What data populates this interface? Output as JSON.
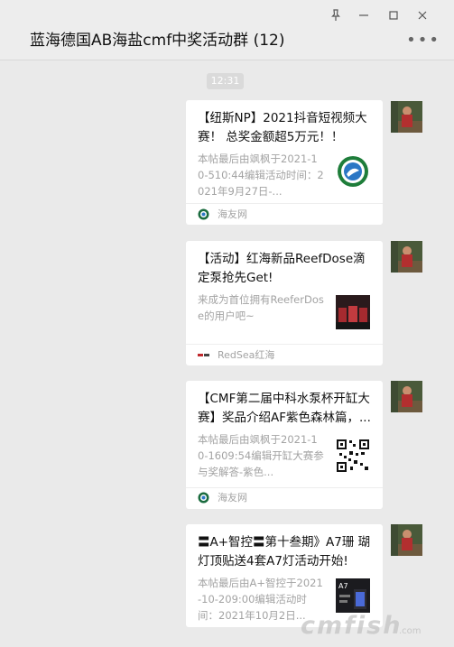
{
  "header": {
    "title": "蓝海德国AB海盐cmf中奖活动群 (12)"
  },
  "window": {
    "pin_icon": "pin-icon",
    "minimize_icon": "minimize-icon",
    "maximize_icon": "maximize-icon",
    "close_icon": "close-icon"
  },
  "time_badge": "12:31",
  "messages": [
    {
      "title": "【纽斯NP】2021抖音短视频大赛！ 总奖金额超5万元！！",
      "desc": "本帖最后由飒枫于2021-10-510:44编辑活动时间：2021年9月27日-...",
      "source": "海友网"
    },
    {
      "title": "【活动】红海新品ReefDose滴定泵抢先Get!",
      "desc": "来成为首位拥有ReeferDose的用户吧~",
      "source": "RedSea红海"
    },
    {
      "title": "【CMF第二届中科水泵杯开缸大赛】奖品介绍AF紫色森林篇，...",
      "desc": "本帖最后由飒枫于2021-10-1609:54编辑开缸大赛参与奖解答-紫色...",
      "source": "海友网"
    },
    {
      "title": "〓A+智控〓第十叁期》A7珊 瑚灯顶贴送4套A7灯活动开始!",
      "desc": "本帖最后由A+智控于2021-10-209:00编辑活动时间：2021年10月2日...",
      "source": ""
    }
  ],
  "watermark": {
    "main": "cmfish",
    "sub": ".com"
  },
  "colors": {
    "background": "#eaeaea",
    "card": "#ffffff",
    "muted_text": "#a3a3a3",
    "badge": "#dadada"
  }
}
